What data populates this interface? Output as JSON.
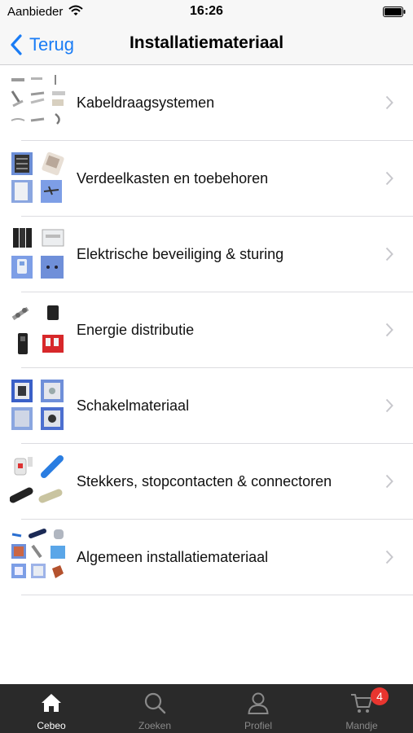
{
  "status_bar": {
    "carrier": "Aanbieder",
    "time": "16:26"
  },
  "nav": {
    "back_label": "Terug",
    "title": "Installatiemateriaal"
  },
  "categories": [
    {
      "label": "Kabeldraagsystemen",
      "thumb_icon": "cable-tray-products"
    },
    {
      "label": "Verdeelkasten en toebehoren",
      "thumb_icon": "distribution-box-products"
    },
    {
      "label": "Elektrische beveiliging & sturing",
      "thumb_icon": "circuit-breaker-products"
    },
    {
      "label": "Energie distributie",
      "thumb_icon": "energy-distribution-products"
    },
    {
      "label": "Schakelmateriaal",
      "thumb_icon": "switch-products"
    },
    {
      "label": "Stekkers, stopcontacten & connectoren",
      "thumb_icon": "plug-socket-products"
    },
    {
      "label": "Algemeen installatiemateriaal",
      "thumb_icon": "general-material-products"
    }
  ],
  "tabs": [
    {
      "label": "Cebeo",
      "icon": "home-icon",
      "active": true
    },
    {
      "label": "Zoeken",
      "icon": "search-icon",
      "active": false
    },
    {
      "label": "Profiel",
      "icon": "profile-icon",
      "active": false
    },
    {
      "label": "Mandje",
      "icon": "cart-icon",
      "active": false,
      "badge": "4"
    }
  ],
  "colors": {
    "accent": "#1a7cf5",
    "tab_bar": "#2a2a2a",
    "badge": "#e8352f"
  }
}
